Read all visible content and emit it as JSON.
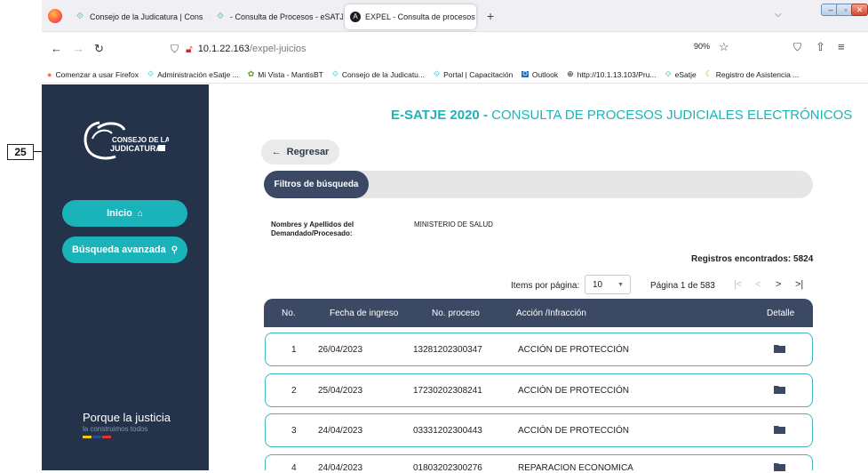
{
  "annotation": {
    "label": "25"
  },
  "browser": {
    "tabs": [
      {
        "label": "Consejo de la Judicatura | Cons",
        "icon": "ecuador-logo-icon",
        "active": false
      },
      {
        "label": "- Consulta de Procesos - eSATJE",
        "icon": "ecuador-logo-icon",
        "active": false
      },
      {
        "label": "EXPEL - Consulta de procesos",
        "icon": "angular-icon",
        "active": true
      }
    ],
    "url_host": "10.1.22.163",
    "url_path": "/expel-juicios",
    "zoom": "90%",
    "bookmarks": [
      {
        "label": "Comenzar a usar Firefox",
        "icon": "firefox-icon"
      },
      {
        "label": "Administración eSatje ...",
        "icon": "ecuador-logo-icon"
      },
      {
        "label": "Mi Vista - MantisBT",
        "icon": "mantis-icon"
      },
      {
        "label": "Consejo de la Judicatu...",
        "icon": "ecuador-logo-icon"
      },
      {
        "label": "Portal | Capacitación",
        "icon": "ecuador-logo-icon"
      },
      {
        "label": "Outlook",
        "icon": "outlook-icon"
      },
      {
        "label": "http://10.1.13.103/Pru...",
        "icon": "globe-icon"
      },
      {
        "label": "eSatje",
        "icon": "ecuador-logo-icon"
      },
      {
        "label": "Registro de Asistencia ...",
        "icon": "registro-icon"
      }
    ]
  },
  "sidebar": {
    "logo_line1": "CONSEJO DE LA",
    "logo_line2": "JUDICATURA",
    "nav": [
      {
        "label": "Inicio",
        "icon": "home-icon"
      },
      {
        "label": "Búsqueda avanzada",
        "icon": "search-icon"
      }
    ],
    "slogan_title": "Porque la justicia",
    "slogan_sub": "la construimos todos"
  },
  "header": {
    "title_strong": "E-SATJE 2020 -",
    "title_light": "CONSULTA DE PROCESOS JUDICIALES ELECTRÓNICOS"
  },
  "back_button": {
    "label": "Regresar",
    "icon": "arrow-left-icon"
  },
  "filters": {
    "tab_label": "Filtros de búsqueda",
    "label_line1": "Nombres y Apellidos del",
    "label_line2": "Demandado/Procesado:",
    "value": "MINISTERIO DE SALUD"
  },
  "results": {
    "records_text": "Registros encontrados: 5824",
    "items_per_page_label": "Items por página:",
    "items_per_page_value": "10",
    "page_info": "Página 1 de 583"
  },
  "table": {
    "headers": [
      "No.",
      "Fecha de ingreso",
      "No. proceso",
      "Acción /Infracción",
      "Detalle"
    ],
    "rows": [
      {
        "no": "1",
        "fecha": "26/04/2023",
        "proceso": "13281202300347",
        "accion": "ACCIÓN DE PROTECCIÓN"
      },
      {
        "no": "2",
        "fecha": "25/04/2023",
        "proceso": "17230202308241",
        "accion": "ACCIÓN DE PROTECCIÓN"
      },
      {
        "no": "3",
        "fecha": "24/04/2023",
        "proceso": "03331202300443",
        "accion": "ACCIÓN DE PROTECCIÓN"
      },
      {
        "no": "4",
        "fecha": "24/04/2023",
        "proceso": "01803202300276",
        "accion": "REPARACION ECONOMICA"
      }
    ]
  },
  "colors": {
    "sidebar_bg": "#24324a",
    "accent_teal": "#1bb3ba",
    "header_dark": "#3b4965"
  }
}
